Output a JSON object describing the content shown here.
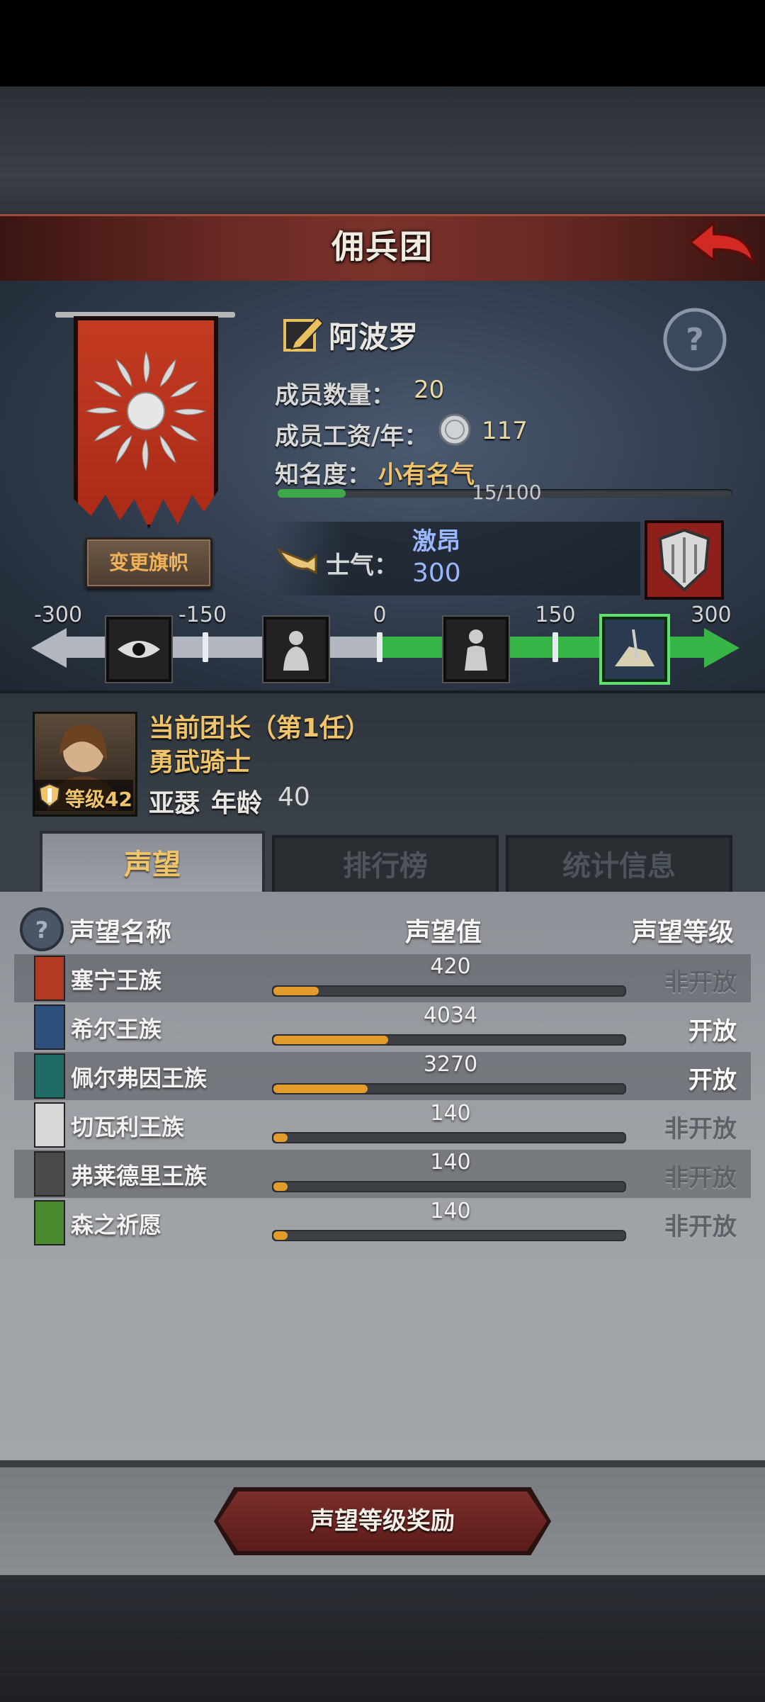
{
  "header": {
    "title": "佣兵团"
  },
  "guild": {
    "name": "阿波罗",
    "change_flag_label": "变更旗帜",
    "members_label": "成员数量：",
    "members_value": "20",
    "wage_label": "成员工资/年：",
    "wage_value": "117",
    "fame_label": "知名度：",
    "fame_value": "小有名气",
    "fame_progress": "15/100",
    "fame_fraction": 0.15,
    "morale_label": "士气：",
    "morale_status": "激昂",
    "morale_value": "300"
  },
  "morale_track": {
    "ticks": [
      {
        "label": "-300",
        "value": -300
      },
      {
        "label": "-150",
        "value": -150
      },
      {
        "label": "0",
        "value": 0
      },
      {
        "label": "150",
        "value": 150
      },
      {
        "label": "300",
        "value": 300
      }
    ],
    "icons": [
      "despair-eye-icon",
      "sad-figure-icon",
      "calm-figure-icon",
      "charging-knight-icon"
    ],
    "active_icon": "charging-knight-icon",
    "colors": {
      "negative": "#b2b7c0",
      "positive": "#37b546"
    }
  },
  "leader": {
    "title": "当前团长（第1任）",
    "class": "勇武骑士",
    "name": "亚瑟",
    "age_label": "年龄",
    "age": "40",
    "level_label": "等级42"
  },
  "tabs": [
    {
      "label": "声望",
      "active": true
    },
    {
      "label": "排行榜",
      "active": false
    },
    {
      "label": "统计信息",
      "active": false
    }
  ],
  "reputation": {
    "columns": {
      "name": "声望名称",
      "value": "声望值",
      "level": "声望等级"
    },
    "rows": [
      {
        "name": "塞宁王族",
        "value": "420",
        "fill": 0.13,
        "status": "非开放",
        "open": false,
        "emblem_color": "#b23a22"
      },
      {
        "name": "希尔王族",
        "value": "4034",
        "fill": 0.33,
        "status": "开放",
        "open": true,
        "emblem_color": "#2d4f7c"
      },
      {
        "name": "佩尔弗因王族",
        "value": "3270",
        "fill": 0.27,
        "status": "开放",
        "open": true,
        "emblem_color": "#1f6b66"
      },
      {
        "name": "切瓦利王族",
        "value": "140",
        "fill": 0.04,
        "status": "非开放",
        "open": false,
        "emblem_color": "#d8d8d8"
      },
      {
        "name": "弗莱德里王族",
        "value": "140",
        "fill": 0.04,
        "status": "非开放",
        "open": false,
        "emblem_color": "#4a4a4a"
      },
      {
        "name": "森之祈愿",
        "value": "140",
        "fill": 0.04,
        "status": "非开放",
        "open": false,
        "emblem_color": "#4a8a2e"
      }
    ]
  },
  "footer": {
    "reward_button_label": "声望等级奖励"
  }
}
